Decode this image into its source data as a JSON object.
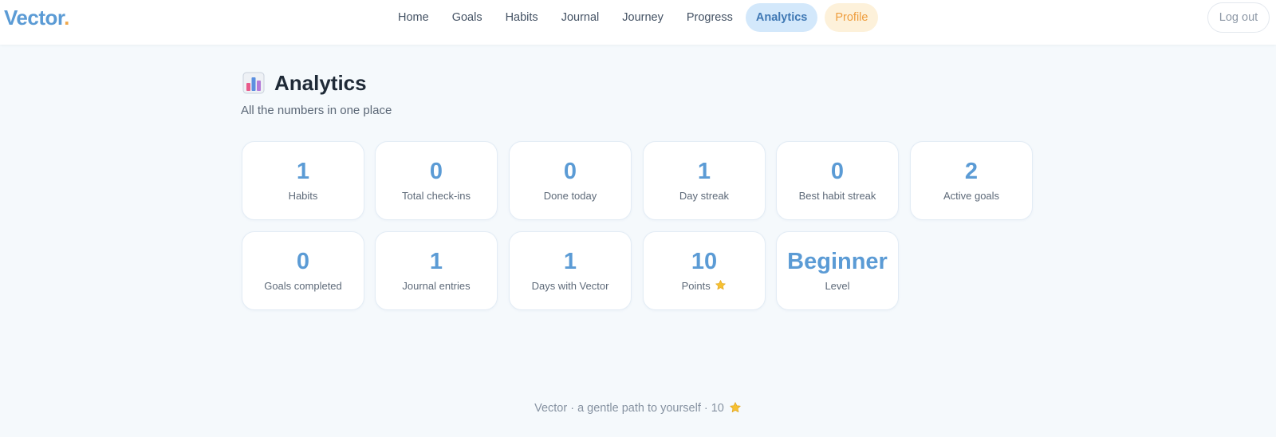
{
  "app": {
    "logo_text": "Vector",
    "logo_dot": ".",
    "brand_color": "#5b9bd5",
    "accent_color": "#f0a74a"
  },
  "nav": {
    "items": [
      {
        "label": "Home"
      },
      {
        "label": "Goals"
      },
      {
        "label": "Habits"
      },
      {
        "label": "Journal"
      },
      {
        "label": "Journey"
      },
      {
        "label": "Progress"
      },
      {
        "label": "Analytics",
        "active": true
      },
      {
        "label": "Profile"
      }
    ],
    "logout_label": "Log out"
  },
  "page": {
    "icon": "bar-chart-icon",
    "title": "Analytics",
    "subtitle": "All the numbers in one place"
  },
  "stats": [
    {
      "value": "1",
      "label": "Habits"
    },
    {
      "value": "0",
      "label": "Total check-ins"
    },
    {
      "value": "0",
      "label": "Done today"
    },
    {
      "value": "1",
      "label": "Day streak"
    },
    {
      "value": "0",
      "label": "Best habit streak"
    },
    {
      "value": "2",
      "label": "Active goals"
    },
    {
      "value": "0",
      "label": "Goals completed"
    },
    {
      "value": "1",
      "label": "Journal entries"
    },
    {
      "value": "1",
      "label": "Days with Vector"
    },
    {
      "value": "10",
      "label": "Points",
      "icon": "star-icon"
    },
    {
      "value": "Beginner",
      "label": "Level"
    }
  ],
  "footer": {
    "text": "Vector · a gentle path to yourself · 10",
    "icon": "star-icon"
  }
}
